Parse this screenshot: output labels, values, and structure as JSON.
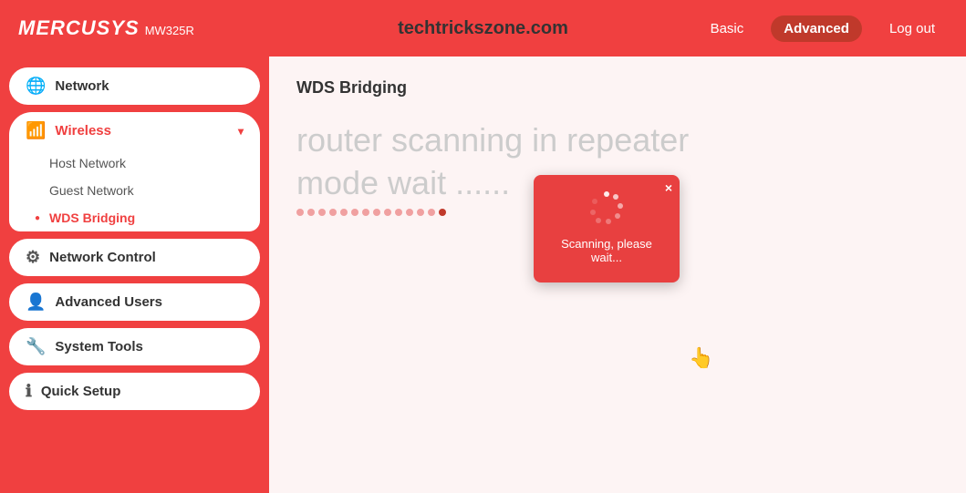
{
  "header": {
    "brand": "MERCUSYS",
    "model": "MW325R",
    "watermark": "techtrickszone.com",
    "nav": {
      "basic_label": "Basic",
      "advanced_label": "Advanced",
      "logout_label": "Log out"
    }
  },
  "sidebar": {
    "network_label": "Network",
    "wireless_label": "Wireless",
    "host_network_label": "Host Network",
    "guest_network_label": "Guest Network",
    "wds_bridging_label": "WDS Bridging",
    "network_control_label": "Network Control",
    "advanced_users_label": "Advanced Users",
    "system_tools_label": "System Tools",
    "quick_setup_label": "Quick Setup"
  },
  "content": {
    "page_title": "WDS Bridging",
    "scanning_text": "router scanning in repeater mode wait ......",
    "modal": {
      "label": "Scanning, please wait...",
      "close": "×"
    }
  }
}
